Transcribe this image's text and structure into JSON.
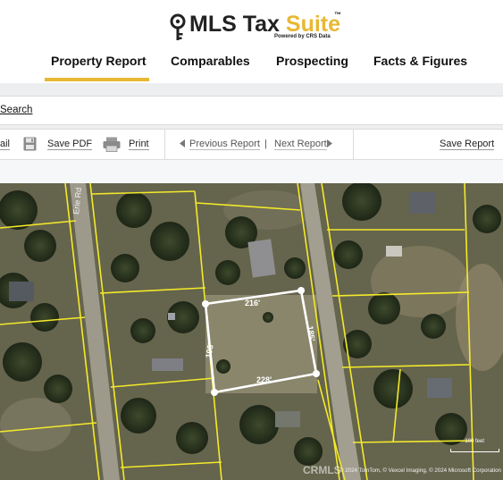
{
  "brand": {
    "name_main": "MLS Tax ",
    "name_accent": "Suite",
    "trademark": "™",
    "powered_by": "Powered by CRS Data",
    "accent_color": "#e8b833"
  },
  "tabs": [
    {
      "label": "Property Report",
      "active": true
    },
    {
      "label": "Comparables",
      "active": false
    },
    {
      "label": "Prospecting",
      "active": false
    },
    {
      "label": "Facts & Figures",
      "active": false
    }
  ],
  "search": {
    "link_label": "Search"
  },
  "toolbar": {
    "email_label": "ail",
    "save_pdf_label": "Save PDF",
    "print_label": "Print",
    "prev_label": "Previous Report",
    "separator": "|",
    "next_label": "Next Report",
    "save_report_label": "Save Report"
  },
  "map": {
    "road_label": "Erie Rd",
    "lot_dimensions": {
      "top": "216'",
      "right": "185'",
      "bottom": "228'",
      "left": "195'"
    },
    "scale_label": "100 feet",
    "attribution": "© 2024 TomTom, © Vexcel Imaging, © 2024 Microsoft Corporation",
    "watermark": "CRMLS",
    "parcel_line_color": "#f4ea2a",
    "subject_outline_color": "#ffffff"
  }
}
